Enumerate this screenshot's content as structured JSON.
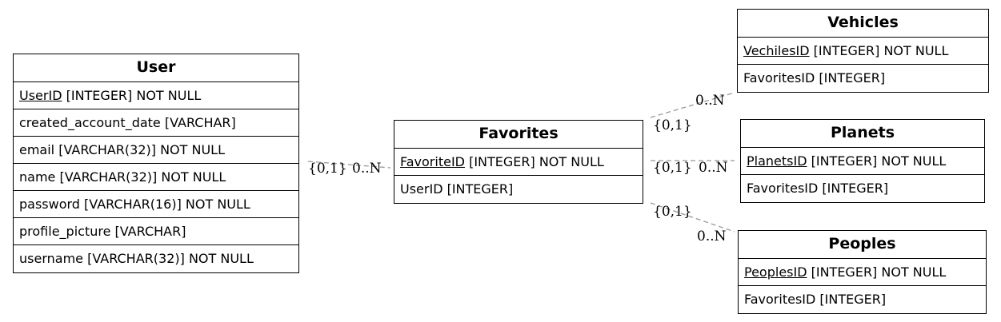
{
  "entities": {
    "user": {
      "title": "User",
      "rows": [
        {
          "key": "UserID",
          "rest": " [INTEGER] NOT NULL"
        },
        {
          "key": "",
          "rest": "created_account_date [VARCHAR]"
        },
        {
          "key": "",
          "rest": "email [VARCHAR(32)] NOT NULL"
        },
        {
          "key": "",
          "rest": "name [VARCHAR(32)] NOT NULL"
        },
        {
          "key": "",
          "rest": "password [VARCHAR(16)] NOT NULL"
        },
        {
          "key": "",
          "rest": "profile_picture [VARCHAR]"
        },
        {
          "key": "",
          "rest": "username [VARCHAR(32)] NOT NULL"
        }
      ]
    },
    "favorites": {
      "title": "Favorites",
      "rows": [
        {
          "key": "FavoriteID",
          "rest": " [INTEGER] NOT NULL"
        },
        {
          "key": "",
          "rest": "UserID [INTEGER]"
        }
      ]
    },
    "vehicles": {
      "title": "Vehicles",
      "rows": [
        {
          "key": "VechilesID",
          "rest": " [INTEGER] NOT NULL"
        },
        {
          "key": "",
          "rest": "FavoritesID [INTEGER]"
        }
      ]
    },
    "planets": {
      "title": "Planets",
      "rows": [
        {
          "key": "PlanetsID",
          "rest": " [INTEGER] NOT NULL"
        },
        {
          "key": "",
          "rest": "FavoritesID [INTEGER]"
        }
      ]
    },
    "peoples": {
      "title": "Peoples",
      "rows": [
        {
          "key": "PeoplesID",
          "rest": " [INTEGER] NOT NULL"
        },
        {
          "key": "",
          "rest": "FavoritesID [INTEGER]"
        }
      ]
    }
  },
  "relations": {
    "user_favorites": {
      "from_card": "{0,1}",
      "to_card": "0..N"
    },
    "favorites_vehicles": {
      "from_card": "{0,1}",
      "to_card": "0..N"
    },
    "favorites_planets": {
      "from_card": "{0,1}",
      "to_card": "0..N"
    },
    "favorites_peoples": {
      "from_card": "{0,1}",
      "to_card": "0..N"
    }
  },
  "colors": {
    "edge": "#999999",
    "border": "#000000"
  }
}
